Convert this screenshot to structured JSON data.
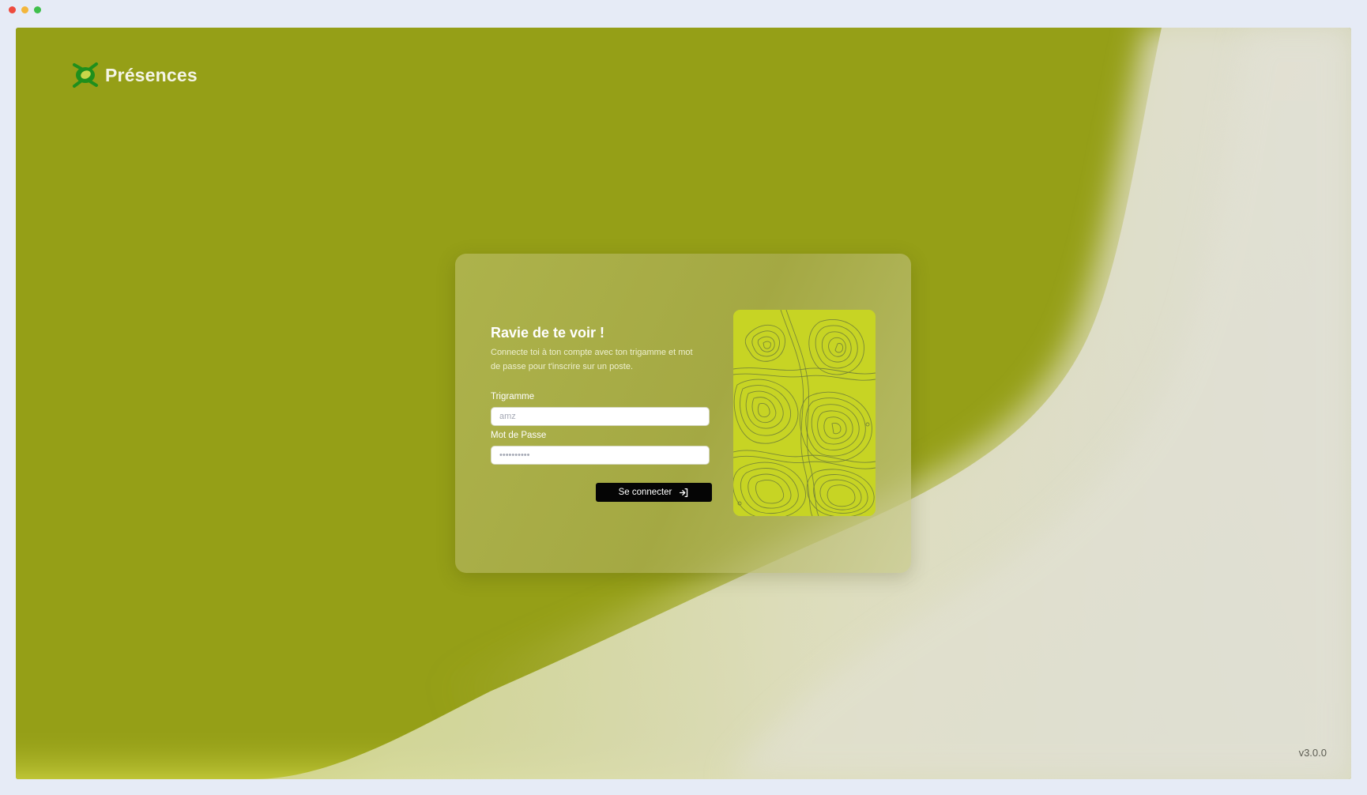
{
  "window": {
    "controls": [
      "close",
      "minimize",
      "maximize"
    ]
  },
  "brand": {
    "name": "Présences",
    "logo_icon": "presences-logo-icon",
    "logo_color": "#1f8f1c"
  },
  "login": {
    "title": "Ravie de te voir !",
    "subtitle": "Connecte toi à ton compte avec ton trigamme et mot de passe pour t'inscrire sur un poste.",
    "trigram_label": "Trigramme",
    "trigram_placeholder": "amz",
    "trigram_value": "",
    "password_label": "Mot de Passe",
    "password_placeholder": "••••••••••",
    "password_value": "",
    "submit_label": "Se connecter",
    "submit_icon": "login-arrow-icon",
    "illustration": "topographic-map-illustration"
  },
  "footer": {
    "version": "v3.0.0"
  },
  "colors": {
    "background_olive": "#959f17",
    "accent_lime": "#c7d424",
    "button_bg": "#050505",
    "page_frame": "#e6ebf6"
  }
}
